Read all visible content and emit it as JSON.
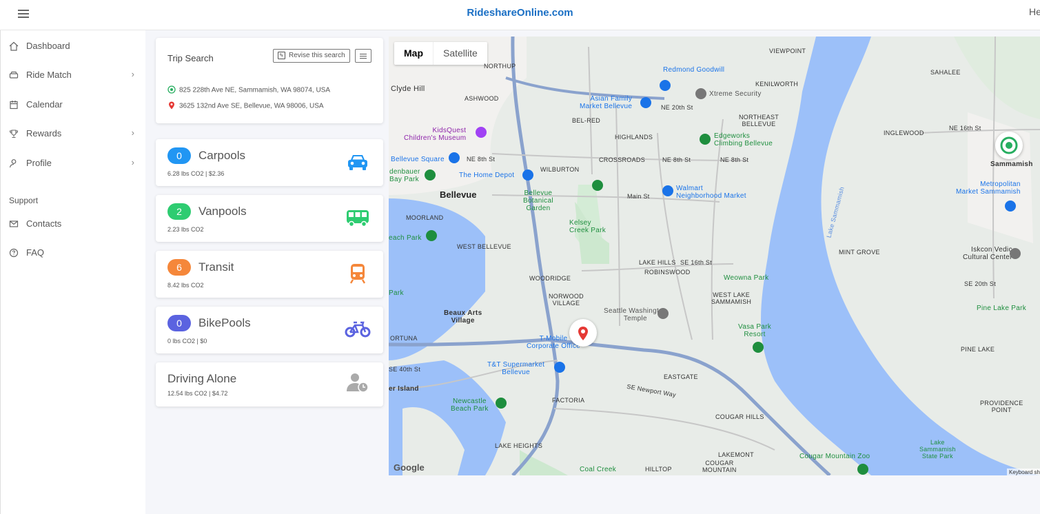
{
  "header": {
    "brand": "RideshareOnline.com",
    "right_text": "He"
  },
  "sidebar": {
    "items": [
      {
        "label": "Dashboard",
        "icon": "home-icon"
      },
      {
        "label": "Ride Match",
        "icon": "car-icon",
        "has_submenu": true
      },
      {
        "label": "Calendar",
        "icon": "calendar-icon"
      },
      {
        "label": "Rewards",
        "icon": "trophy-icon",
        "has_submenu": true
      },
      {
        "label": "Profile",
        "icon": "user-icon",
        "has_submenu": true
      }
    ],
    "support_heading": "Support",
    "support_items": [
      {
        "label": "Contacts",
        "icon": "mail-icon"
      },
      {
        "label": "FAQ",
        "icon": "help-circle-icon"
      }
    ]
  },
  "trip_search": {
    "title": "Trip Search",
    "revise_label": "Revise this search",
    "origin": "825 228th Ave NE, Sammamish, WA 98074, USA",
    "destination": "3625 132nd Ave SE, Bellevue, WA 98006, USA"
  },
  "modes": [
    {
      "count": "0",
      "title": "Carpools",
      "sub": "6.28 lbs CO2 | $2.36",
      "color": "#2196f3",
      "icon": "car-icon"
    },
    {
      "count": "2",
      "title": "Vanpools",
      "sub": "2.23 lbs CO2",
      "color": "#2ecc71",
      "icon": "van-icon"
    },
    {
      "count": "6",
      "title": "Transit",
      "sub": "8.42 lbs CO2",
      "color": "#f5873a",
      "icon": "train-icon"
    },
    {
      "count": "0",
      "title": "BikePools",
      "sub": "0 lbs CO2 | $0",
      "color": "#5b63e0",
      "icon": "bicycle-icon"
    }
  ],
  "driving_alone": {
    "title": "Driving Alone",
    "sub": "12.54 lbs CO2 | $4.72",
    "icon": "user-clock-icon"
  },
  "map": {
    "type_buttons": [
      "Map",
      "Satellite"
    ],
    "labels": {
      "viewpoint": "VIEWPOINT",
      "sahalee": "SAHALEE",
      "northup": "NORTHUP",
      "redmond_goodwill": "Redmond Goodwill",
      "clyde_hill": "Clyde Hill",
      "ashwood": "ASHWOOD",
      "kenilworth": "KENILWORTH",
      "xtreme": "Xtreme Security",
      "asian_family": "Asian Family\nMarket Bellevue",
      "ne20th": "NE 20th St",
      "northeast_bellevue": "NORTHEAST\nBELLEVUE",
      "bel_red": "BEL-RED",
      "highlands": "HIGHLANDS",
      "kidsquest": "KidsQuest\nChildren's Museum",
      "edgeworks": "Edgeworks\nClimbing Bellevue",
      "inglewood": "INGLEWOOD",
      "ne16th": "NE 16th St",
      "bellevue_square": "Bellevue Square",
      "ne8th_a": "NE 8th St",
      "crossroads": "CROSSROADS",
      "ne8th_b": "NE 8th St",
      "ne8th_c": "NE 8th St",
      "sammamish": "Sammamish",
      "denbauer": "denbauer\nBay Park",
      "wilburton": "WILBURTON",
      "home_depot": "The Home Depot",
      "bellevue": "Bellevue",
      "walmart": "Walmart\nNeighborhood Market",
      "metropolitan": "Metropolitan\nMarket Sammamish",
      "botanical": "Bellevue\nBotanical\nGarden",
      "main_st": "Main St",
      "moorland": "MOORLAND",
      "kelsey": "Kelsey\nCreek Park",
      "lake_sammamish": "Lake Sammamish",
      "each_park": "each Park",
      "west_bellevue": "WEST BELLEVUE",
      "mint_grove": "MINT GROVE",
      "iskcon": "Iskcon Vedic\nCultural Center",
      "lake_hills": "LAKE HILLS",
      "se16th": "SE 16th St",
      "robinswood": "ROBINSWOOD",
      "woodridge": "WOODRIDGE",
      "weowna": "Weowna Park",
      "se20th": "SE 20th St",
      "norwood": "NORWOOD\nVILLAGE",
      "west_lake": "WEST LAKE\nSAMMAMISH",
      "pine_lake_park": "Pine Lake Park",
      "seattle_temple": "Seattle Washington\nTemple",
      "beaux_arts": "Beaux Arts\nVillage",
      "vasa_park": "Vasa Park\nResort",
      "ortuna": "ORTUNA",
      "tmobile": "T-Mobile\nCorporate Office",
      "pine_lake": "PINE LAKE",
      "se40th": "SE 40th St",
      "tt_market": "T&T Supermarket\nBellevue",
      "eastgate": "EASTGATE",
      "se_newport": "SE Newport Way",
      "er_island": "er Island",
      "factoria": "FACTORIA",
      "newcastle": "Newcastle\nBeach Park",
      "providence": "PROVIDENCE\nPOINT",
      "cougar_hills": "COUGAR HILLS",
      "lake_heights": "LAKE HEIGHTS",
      "lakemont": "LAKEMONT",
      "cougar_zoo": "Cougar Mountain Zoo",
      "lake_sammamish_sp": "Lake\nSammamish\nState Park",
      "coal_creek": "Coal Creek",
      "hilltop": "HILLTOP",
      "cougar_mountain": "COUGAR\nMOUNTAIN",
      "park": "Park"
    },
    "google": "Google",
    "keyboard": "Keyboard sho"
  }
}
